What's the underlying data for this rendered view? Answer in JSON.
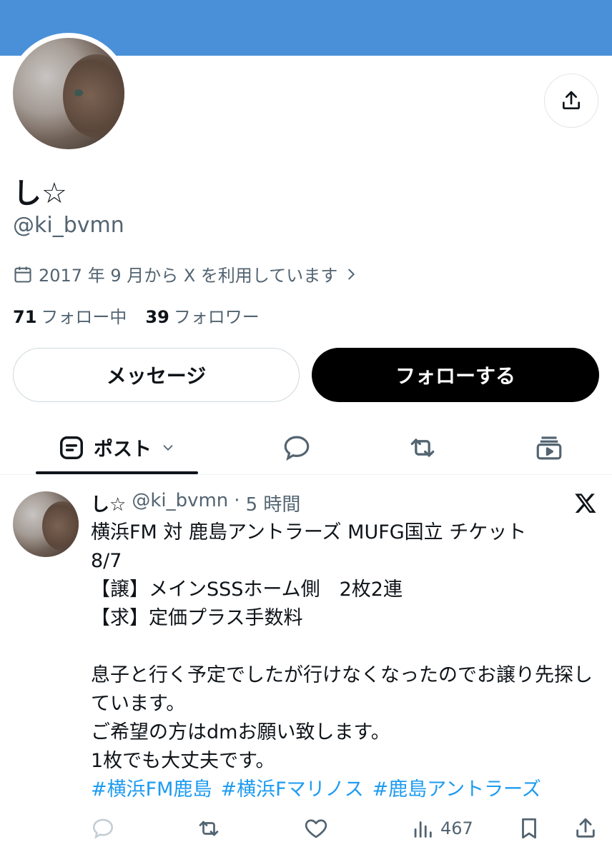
{
  "colors": {
    "banner": "#4a90d9",
    "text": "#0f1419",
    "muted": "#536471",
    "link": "#1d9bf0"
  },
  "profile": {
    "display_name": "し☆",
    "handle": "@ki_bvmn",
    "joined": "2017 年 9 月から X を利用しています",
    "following_count": "71",
    "following_label": "フォロー中",
    "followers_count": "39",
    "followers_label": "フォロワー"
  },
  "buttons": {
    "message": "メッセージ",
    "follow": "フォローする"
  },
  "tabs": [
    {
      "label": "ポスト",
      "icon": "posts-icon",
      "active": true
    },
    {
      "label": "",
      "icon": "replies-icon"
    },
    {
      "label": "",
      "icon": "reposts-icon"
    },
    {
      "label": "",
      "icon": "media-icon"
    }
  ],
  "tweet": {
    "name": "し☆",
    "handle": "@ki_bvmn",
    "separator": "·",
    "time": "5 時間",
    "body": "横浜FM 対 鹿島アントラーズ MUFG国立 チケット\n8/7\n【譲】メインSSSホーム側　2枚2連\n【求】定価プラス手数料\n\n息子と行く予定でしたが行けなくなったのでお譲り先探しています。\nご希望の方はdmお願い致します。\n1枚でも大丈夫です。",
    "hashtags": [
      "#横浜FM鹿島",
      "#横浜Fマリノス",
      "#鹿島アントラーズ"
    ],
    "views": "467"
  }
}
